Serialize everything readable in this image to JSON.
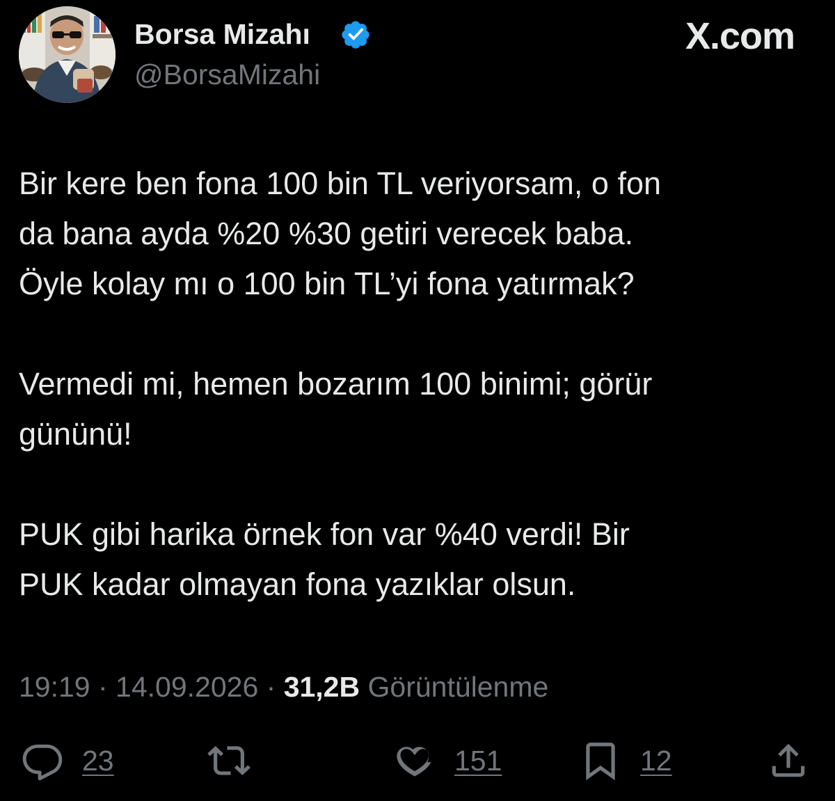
{
  "brand": "X.com",
  "author": {
    "display_name": "Borsa Mizahı",
    "handle": "@BorsaMizahi",
    "verified": true,
    "verified_color": "#1d9bf0",
    "avatar_icon": "profile-photo"
  },
  "tweet": {
    "paragraphs": [
      "Bir kere ben fona 100 bin TL veriyorsam, o fon\nda bana ayda %20 %30 getiri verecek baba.\nÖyle kolay mı o 100 bin TL’yi fona yatırmak?",
      "Vermedi mi, hemen bozarım 100 binimi; görür\ngününü!",
      "PUK gibi harika örnek fon var %40 verdi! Bir\nPUK kadar olmayan fona yazıklar olsun."
    ],
    "time": "19:19",
    "separator": " · ",
    "date": "14.09.2026",
    "views_count": "31,2B",
    "views_label": " Görüntülenme"
  },
  "actions": {
    "reply": {
      "icon": "reply-icon",
      "count": "23"
    },
    "retweet": {
      "icon": "retweet-icon",
      "count": ""
    },
    "like": {
      "icon": "heart-icon",
      "count": "151"
    },
    "bookmark": {
      "icon": "bookmark-icon",
      "count": "12"
    },
    "share": {
      "icon": "share-icon",
      "count": ""
    }
  },
  "colors": {
    "background": "#000000",
    "primary_text": "#e7e9ea",
    "secondary_text": "#71767b"
  }
}
